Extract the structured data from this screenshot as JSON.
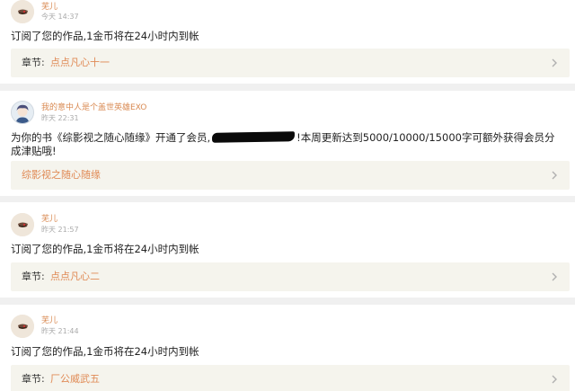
{
  "notifications": [
    {
      "user": "芜儿",
      "time": "今天 14:37",
      "message": "订阅了您的作品,1金币将在24小时内到帐",
      "chapter_prefix": "章节:",
      "chapter_title": "点点凡心十一",
      "avatar": "cup-avatar"
    },
    {
      "user": "我的意中人是个盖世英雄EXO",
      "time": "昨天 22:31",
      "message_before": "为你的书《综影视之随心随缘》开通了会员,",
      "message_after": "!本周更新达到5000/10000/15000字可额外获得会员分成津贴哦!",
      "chapter_title": "综影视之随心随缘",
      "avatar": "anime-avatar"
    },
    {
      "user": "芜儿",
      "time": "昨天 21:57",
      "message": "订阅了您的作品,1金币将在24小时内到帐",
      "chapter_prefix": "章节:",
      "chapter_title": "点点凡心二",
      "avatar": "cup-avatar"
    },
    {
      "user": "芜儿",
      "time": "昨天 21:44",
      "message": "订阅了您的作品,1金币将在24小时内到帐",
      "chapter_prefix": "章节:",
      "chapter_title": "厂公威武五",
      "avatar": "cup-avatar"
    }
  ],
  "icons": {
    "chevron": "chevron-right-icon",
    "redaction": "redaction-mark"
  },
  "colors": {
    "accent": "#e08a55",
    "name": "#d98a52",
    "chapter_bg": "#f5f4ed",
    "page_bg": "#f0f0f0"
  }
}
